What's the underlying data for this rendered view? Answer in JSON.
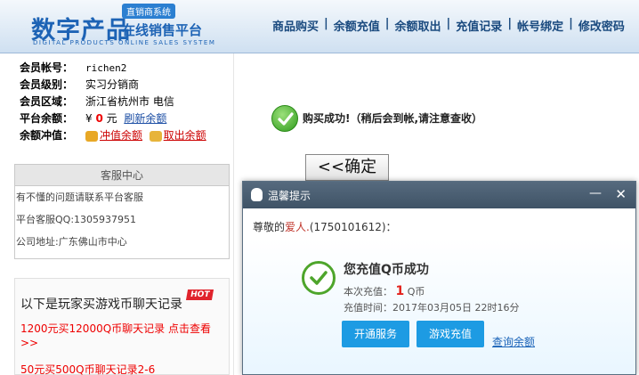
{
  "header": {
    "logo_main": "数字产品",
    "logo_badge": "直销商系统",
    "logo_sub": "在线销售平台",
    "logo_en": "DIGITAL PRODUCTS ONLINE SALES SYSTEM",
    "nav": [
      "商品购买",
      "余额充值",
      "余额取出",
      "充值记录",
      "帐号绑定",
      "修改密码"
    ]
  },
  "account": {
    "id_label": "会员帐号：",
    "id_value": "richen2",
    "level_label": "会员级别：",
    "level_value": "实习分销商",
    "region_label": "会员区域：",
    "region_value": "浙江省杭州市 电信",
    "balance_label": "平台余额：",
    "currency": "¥",
    "balance": "0",
    "unit": "元",
    "refresh_link": "刷新余额",
    "topup_label": "余额冲值：",
    "topup_link": "冲值余额",
    "withdraw_link": "取出余额"
  },
  "service": {
    "title": "客服中心",
    "lines": [
      "有不懂的问题请联系平台客服",
      "平台客服QQ:1305937951",
      "公司地址:广东佛山市中心"
    ]
  },
  "records": {
    "title": "以下是玩家买游戏币聊天记录",
    "hot": "HOT",
    "link1": "1200元买12000Q币聊天记录 点击查看>>",
    "link2": "50元买500Q币聊天记录2-6"
  },
  "main": {
    "success": "购买成功!（稍后会到帐,请注意查收）",
    "confirm": "<<确定"
  },
  "dialog": {
    "title": "温馨提示",
    "min": "—",
    "close": "✕",
    "greet_pre": "尊敬的",
    "nickname": "爱人.",
    "greet_post": "(1750101612)：",
    "headline": "您充值Q币成功",
    "amount_label": "本次充值：",
    "amount": "1",
    "amount_unit": "Q币",
    "time_label": "充值时间：",
    "time": "2017年03月05日 22时16分",
    "btn_open": "开通服务",
    "btn_game": "游戏充值",
    "link_balance": "查询余额"
  }
}
